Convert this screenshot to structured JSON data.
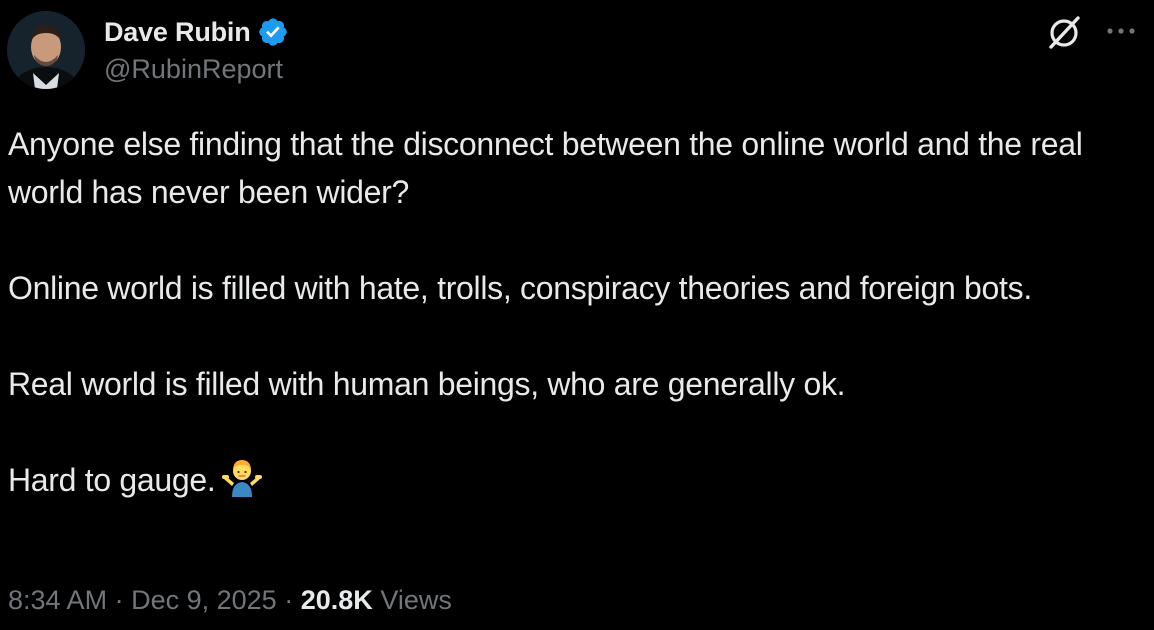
{
  "author": {
    "display_name": "Dave Rubin",
    "handle": "@RubinReport",
    "verified": true,
    "verified_color": "#1d9bf0"
  },
  "header_icons": [
    "grok-icon",
    "more-options-icon"
  ],
  "tweet": {
    "paragraphs": [
      "Anyone else finding that the disconnect between the online world and the real world has never been wider?",
      "Online world is filled with hate, trolls, conspiracy theories and foreign bots.",
      "Real world is filled with human beings, who are generally ok.",
      "Hard to gauge."
    ],
    "emoji": "person-shrugging-emoji"
  },
  "meta": {
    "time": "8:34 AM",
    "separator": "·",
    "date": "Dec 9, 2025",
    "views_count": "20.8K",
    "views_label": "Views"
  },
  "colors": {
    "background": "#000000",
    "primary_text": "#e7e9ea",
    "secondary_text": "#71767b"
  }
}
